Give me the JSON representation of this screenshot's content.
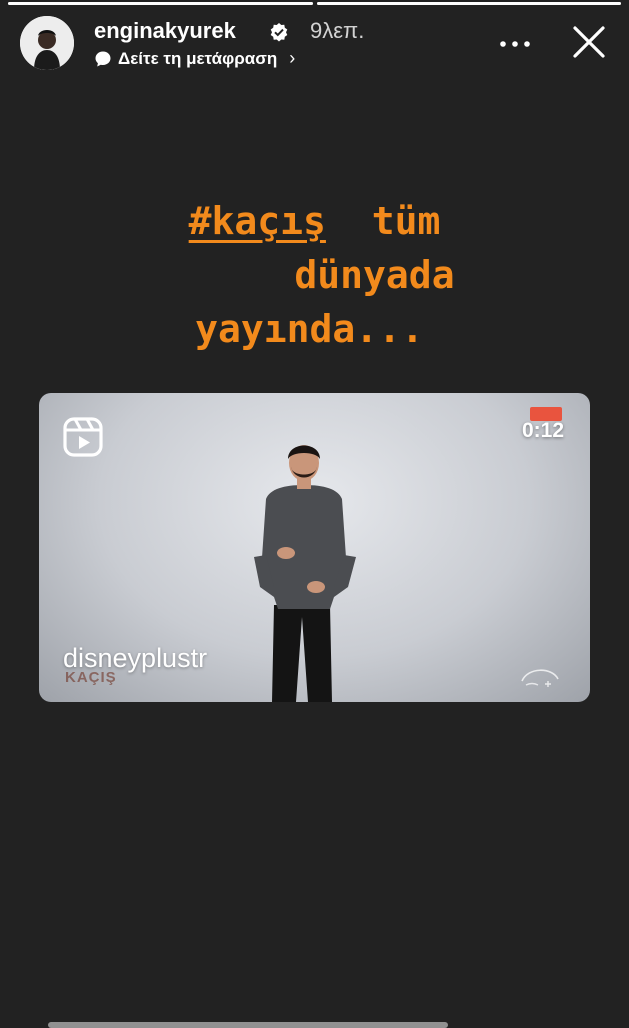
{
  "story": {
    "progress": [
      {
        "fill": 1.0
      },
      {
        "fill": 1.0
      }
    ],
    "username": "enginakyurek",
    "time_ago": "9λεπ.",
    "translate_label": "Δείτε τη μετάφραση",
    "icons": {
      "avatar": "avatar",
      "verified": "verified-badge-icon",
      "more": "more-horizontal-icon",
      "close": "close-icon",
      "translate": "speech-bubble-icon"
    }
  },
  "caption": {
    "hashtag": "#kaçış",
    "line1_rest": "tüm",
    "line2": "dünyada",
    "line3": "yayında...",
    "color": "#f28a1c"
  },
  "reel": {
    "duration": "0:12",
    "author": "disneyplustr",
    "show_logo_text": "KAÇIŞ",
    "icons": {
      "reels": "reels-icon",
      "brand": "disney-plus-logo"
    }
  },
  "colors": {
    "background": "#222222",
    "text": "#ffffff",
    "accent": "#f28a1c"
  }
}
